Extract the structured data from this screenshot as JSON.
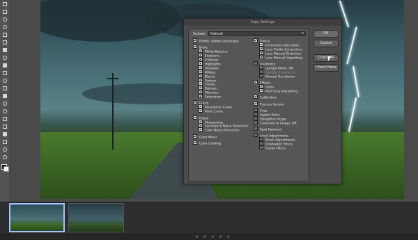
{
  "dialog": {
    "title": "Copy Settings",
    "subset_label": "Subset:",
    "subset_value": "Default",
    "buttons": {
      "ok": "OK",
      "cancel": "Cancel",
      "check_all": "Check All",
      "check_none": "Check None"
    },
    "left_column": [
      {
        "label": "Profile: Adobe Landscape",
        "checked": true,
        "level": 0
      },
      {
        "gap": true
      },
      {
        "label": "Basic",
        "checked": true,
        "level": 0
      },
      {
        "label": "White Balance",
        "checked": true,
        "level": 1
      },
      {
        "label": "Exposure",
        "checked": true,
        "level": 1
      },
      {
        "label": "Contrast",
        "checked": true,
        "level": 1
      },
      {
        "label": "Highlights",
        "checked": true,
        "level": 1
      },
      {
        "label": "Shadows",
        "checked": true,
        "level": 1
      },
      {
        "label": "Whites",
        "checked": true,
        "level": 1
      },
      {
        "label": "Blacks",
        "checked": true,
        "level": 1
      },
      {
        "label": "Texture",
        "checked": true,
        "level": 1
      },
      {
        "label": "Clarity",
        "checked": true,
        "level": 1
      },
      {
        "label": "Dehaze",
        "checked": true,
        "level": 1
      },
      {
        "label": "Vibrance",
        "checked": true,
        "level": 1
      },
      {
        "label": "Saturation",
        "checked": true,
        "level": 1
      },
      {
        "gap": true
      },
      {
        "label": "Curve",
        "checked": true,
        "level": 0
      },
      {
        "label": "Parametric Curve",
        "checked": true,
        "level": 1
      },
      {
        "label": "Point Curve",
        "checked": true,
        "level": 1
      },
      {
        "gap": true
      },
      {
        "label": "Detail",
        "checked": true,
        "level": 0
      },
      {
        "label": "Sharpening",
        "checked": true,
        "level": 1
      },
      {
        "label": "Luminance Noise Reduction",
        "checked": true,
        "level": 1
      },
      {
        "label": "Color Noise Reduction",
        "checked": true,
        "level": 1
      },
      {
        "gap": true
      },
      {
        "label": "Color Mixer",
        "checked": true,
        "level": 0
      },
      {
        "gap": true
      },
      {
        "label": "Color Grading",
        "checked": true,
        "level": 0
      }
    ],
    "right_column": [
      {
        "label": "Optics",
        "checked": true,
        "level": 0
      },
      {
        "label": "Chromatic Aberration",
        "checked": true,
        "level": 1
      },
      {
        "label": "Lens Profile Corrections",
        "checked": true,
        "level": 1
      },
      {
        "label": "Lens Manual Distortion",
        "checked": true,
        "level": 1
      },
      {
        "label": "Lens Manual Vignetting",
        "checked": true,
        "level": 1
      },
      {
        "gap": true
      },
      {
        "label": "Geometry",
        "checked": false,
        "level": 0
      },
      {
        "label": "Upright Mode: Off",
        "checked": false,
        "level": 1
      },
      {
        "label": "Upright Transforms",
        "checked": false,
        "level": 1,
        "disabled": true
      },
      {
        "label": "Manual Transforms",
        "checked": false,
        "level": 1
      },
      {
        "gap": true
      },
      {
        "label": "Effects",
        "checked": true,
        "level": 0
      },
      {
        "label": "Grain",
        "checked": true,
        "level": 1
      },
      {
        "label": "Post Crop Vignetting",
        "checked": true,
        "level": 1
      },
      {
        "gap": true
      },
      {
        "label": "Calibration",
        "checked": true,
        "level": 0
      },
      {
        "gap": true
      },
      {
        "label": "Process Version",
        "checked": true,
        "level": 0
      },
      {
        "gap": true
      },
      {
        "label": "Crop",
        "checked": false,
        "level": 0
      },
      {
        "label": "Aspect Ratio",
        "checked": false,
        "level": 0
      },
      {
        "label": "Straighten Angle",
        "checked": false,
        "level": 0
      },
      {
        "label": "Constrain to Image: Off",
        "checked": false,
        "level": 0
      },
      {
        "gap": true
      },
      {
        "label": "Spot Removal",
        "checked": false,
        "level": 0
      },
      {
        "gap": true
      },
      {
        "label": "Local Adjustments",
        "checked": false,
        "level": 0
      },
      {
        "label": "Brush Adjustments",
        "checked": false,
        "level": 1
      },
      {
        "label": "Graduated Filters",
        "checked": false,
        "level": 1
      },
      {
        "label": "Radial Filters",
        "checked": false,
        "level": 1
      }
    ]
  },
  "filmstrip": {
    "status_text": "",
    "rating_stars": "★ ★ ★ ★ ★"
  }
}
